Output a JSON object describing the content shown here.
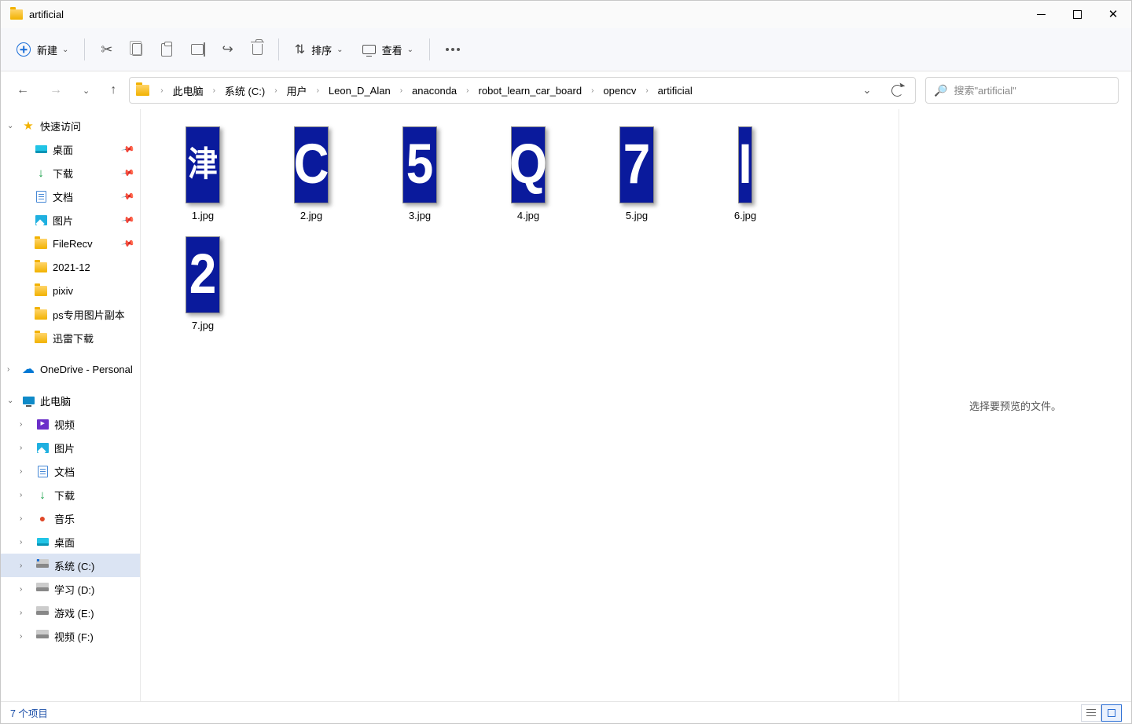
{
  "window": {
    "title": "artificial"
  },
  "toolbar": {
    "new_label": "新建",
    "sort_label": "排序",
    "view_label": "查看"
  },
  "breadcrumb": {
    "items": [
      "此电脑",
      "系统 (C:)",
      "用户",
      "Leon_D_Alan",
      "anaconda",
      "robot_learn_car_board",
      "opencv",
      "artificial"
    ]
  },
  "search": {
    "placeholder": "搜索\"artificial\""
  },
  "sidebar": {
    "quick_access": "快速访问",
    "desktop": "桌面",
    "downloads": "下载",
    "documents": "文档",
    "pictures": "图片",
    "filerecv": "FileRecv",
    "f_202112": "2021-12",
    "pixiv": "pixiv",
    "ps_copy": "ps专用图片副本",
    "xunlei": "迅雷下载",
    "onedrive": "OneDrive - Personal",
    "this_pc": "此电脑",
    "video": "视频",
    "pictures2": "图片",
    "documents2": "文档",
    "downloads2": "下载",
    "music": "音乐",
    "desktop2": "桌面",
    "drive_c": "系统 (C:)",
    "drive_d": "学习 (D:)",
    "drive_e": "游戏 (E:)",
    "drive_f": "视频 (F:)"
  },
  "files": [
    {
      "name": "1.jpg",
      "glyph": "津",
      "cn": true
    },
    {
      "name": "2.jpg",
      "glyph": "C"
    },
    {
      "name": "3.jpg",
      "glyph": "5"
    },
    {
      "name": "4.jpg",
      "glyph": "Q"
    },
    {
      "name": "5.jpg",
      "glyph": "7"
    },
    {
      "name": "6.jpg",
      "glyph": "I",
      "narrow": true
    },
    {
      "name": "7.jpg",
      "glyph": "2"
    }
  ],
  "preview": {
    "empty_text": "选择要预览的文件。"
  },
  "status": {
    "text": "7 个项目"
  }
}
